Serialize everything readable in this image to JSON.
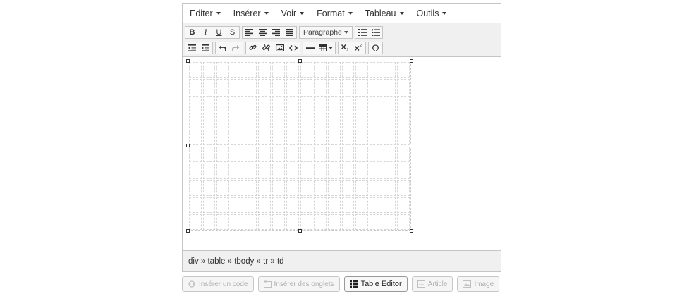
{
  "menubar": {
    "items": [
      {
        "label": "Editer"
      },
      {
        "label": "Insérer"
      },
      {
        "label": "Voir"
      },
      {
        "label": "Format"
      },
      {
        "label": "Tableau"
      },
      {
        "label": "Outils"
      }
    ]
  },
  "toolbar": {
    "bold": "B",
    "italic": "I",
    "underline": "U",
    "strikethrough": "S",
    "paragraph_select": "Paragraphe",
    "omega": "Ω"
  },
  "table": {
    "rows": 10,
    "columns": 16
  },
  "statusbar": {
    "path": "div » table » tbody » tr » td"
  },
  "bottom_buttons": [
    {
      "label": "Insérer un code",
      "icon": "code-icon",
      "active": false
    },
    {
      "label": "Insérer des onglets",
      "icon": "tabs-icon",
      "active": false
    },
    {
      "label": "Table Editor",
      "icon": "table-list-icon",
      "active": true
    },
    {
      "label": "Article",
      "icon": "article-icon",
      "active": false
    },
    {
      "label": "Image",
      "icon": "image-icon",
      "active": false
    }
  ]
}
